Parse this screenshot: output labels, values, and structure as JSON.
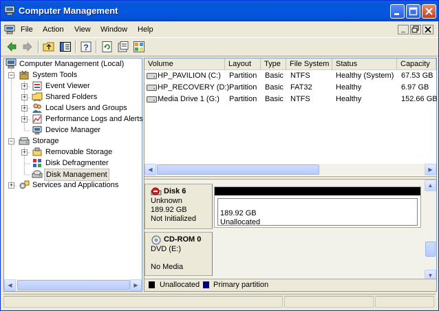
{
  "window": {
    "title": "Computer Management"
  },
  "menu": [
    "File",
    "Action",
    "View",
    "Window",
    "Help"
  ],
  "toolbar": [
    "back-icon",
    "forward-icon",
    "up-folder-icon",
    "show-hide-tree-icon",
    "help-icon",
    "refresh-icon",
    "properties-icon",
    "export-icon"
  ],
  "tree": {
    "root": "Computer Management (Local)",
    "system_tools": "System Tools",
    "event_viewer": "Event Viewer",
    "shared_folders": "Shared Folders",
    "local_users": "Local Users and Groups",
    "perf_logs": "Performance Logs and Alerts",
    "device_manager": "Device Manager",
    "storage": "Storage",
    "removable_storage": "Removable Storage",
    "disk_defrag": "Disk Defragmenter",
    "disk_management": "Disk Management",
    "services": "Services and Applications"
  },
  "volumes": {
    "columns": [
      "Volume",
      "Layout",
      "Type",
      "File System",
      "Status",
      "Capacity"
    ],
    "rows": [
      [
        "HP_PAVILION (C:)",
        "Partition",
        "Basic",
        "NTFS",
        "Healthy (System)",
        "67.53 GB"
      ],
      [
        "HP_RECOVERY (D:)",
        "Partition",
        "Basic",
        "FAT32",
        "Healthy",
        "6.97 GB"
      ],
      [
        "Media Drive 1 (G:)",
        "Partition",
        "Basic",
        "NTFS",
        "Healthy",
        "152.66 GB"
      ]
    ]
  },
  "disks": {
    "disk6": {
      "name": "Disk 6",
      "type": "Unknown",
      "size": "189.92 GB",
      "state": "Not Initialized",
      "region_size": "189.92 GB",
      "region_label": "Unallocated"
    },
    "cdrom0": {
      "name": "CD-ROM 0",
      "drive": "DVD (E:)",
      "media": "No Media"
    }
  },
  "legend": {
    "unallocated": "Unallocated",
    "primary": "Primary partition",
    "unallocated_color": "#000000",
    "primary_color": "#000080"
  }
}
